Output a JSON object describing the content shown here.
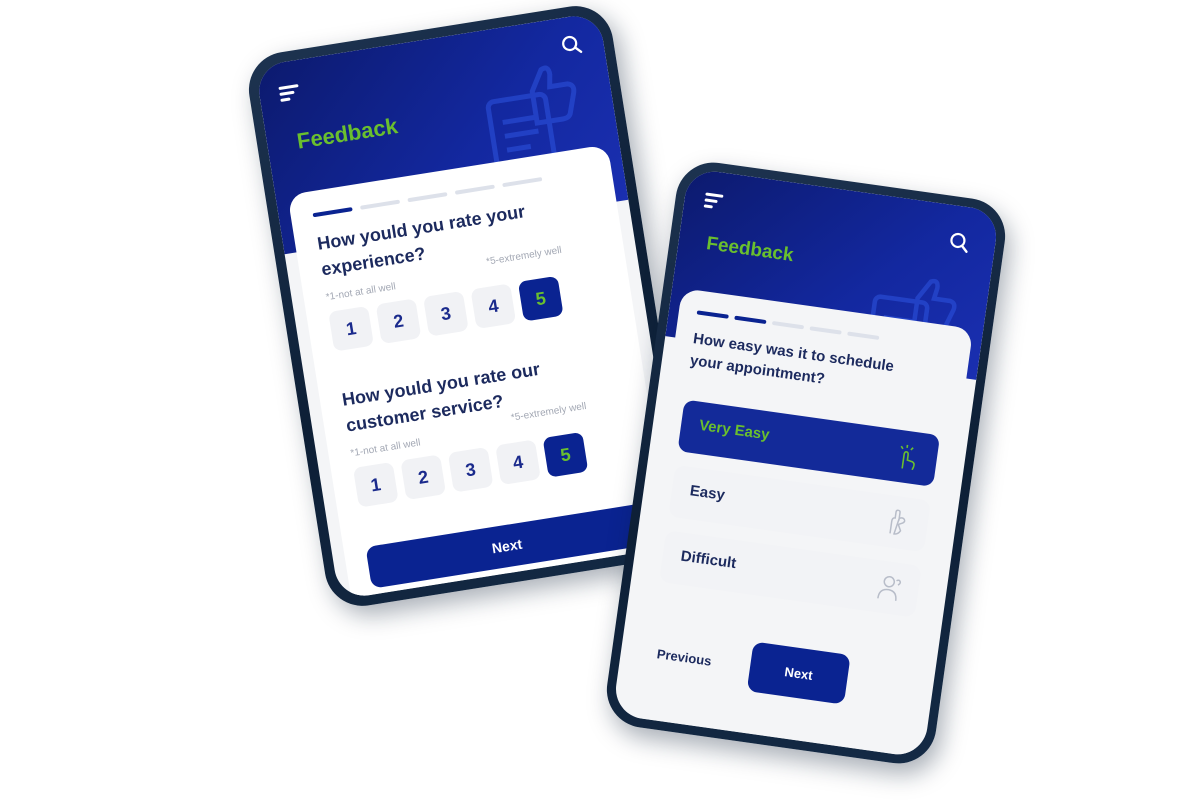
{
  "colors": {
    "brand_blue": "#0a2391",
    "accent_green": "#6abf2e",
    "header_dark": "#0c1a6e",
    "text_dark": "#1c2a5e",
    "hint_grey": "#a3a8b4"
  },
  "screen1": {
    "header": {
      "title": "Feedback",
      "menu_icon": "menu-icon",
      "search_icon": "search-icon",
      "decoration_icon": "thumbs-up-clipboard-icon"
    },
    "progress": {
      "total_steps": 5,
      "current_step": 1
    },
    "questions": [
      {
        "text": "How yould you rate your experience?",
        "hint_low": "*1-not at all well",
        "hint_high": "*5-extremely well",
        "options": [
          "1",
          "2",
          "3",
          "4",
          "5"
        ],
        "selected": "5"
      },
      {
        "text": "How yould you rate our customer service?",
        "hint_low": "*1-not at all well",
        "hint_high": "*5-extremely well",
        "options": [
          "1",
          "2",
          "3",
          "4",
          "5"
        ],
        "selected": "5"
      }
    ],
    "next_label": "Next"
  },
  "screen2": {
    "header": {
      "title": "Feedback",
      "menu_icon": "menu-icon",
      "search_icon": "search-icon",
      "decoration_icon": "thumbs-up-clipboard-icon"
    },
    "progress": {
      "total_steps": 5,
      "current_step": 2
    },
    "question": "How easy was it to schedule your appointment?",
    "options": [
      {
        "label": "Very Easy",
        "icon": "tap-hand-icon",
        "selected": true
      },
      {
        "label": "Easy",
        "icon": "ok-hand-icon",
        "selected": false
      },
      {
        "label": "Difficult",
        "icon": "confused-person-icon",
        "selected": false
      }
    ],
    "previous_label": "Previous",
    "next_label": "Next"
  }
}
